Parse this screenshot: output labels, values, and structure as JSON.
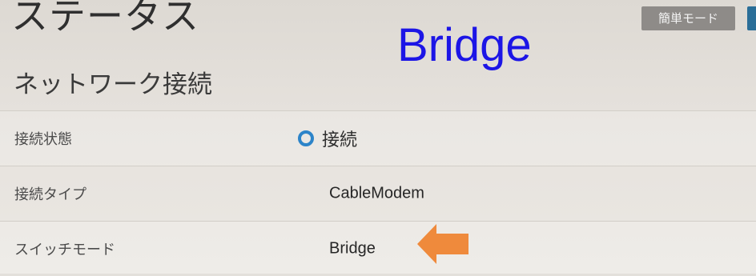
{
  "header": {
    "title": "ステータス",
    "simple_mode_label": "簡単モード"
  },
  "overlay": {
    "label": "Bridge",
    "color": "#1c15e6"
  },
  "section": {
    "title": "ネットワーク接続"
  },
  "rows": [
    {
      "label": "接続状態",
      "value": "接続",
      "icon": "connected-ring-icon",
      "icon_color": "#2c84c9"
    },
    {
      "label": "接続タイプ",
      "value": "CableModem"
    },
    {
      "label": "スイッチモード",
      "value": "Bridge"
    }
  ],
  "annotation": {
    "icon": "left-arrow-icon",
    "color": "#ef8a3c"
  }
}
